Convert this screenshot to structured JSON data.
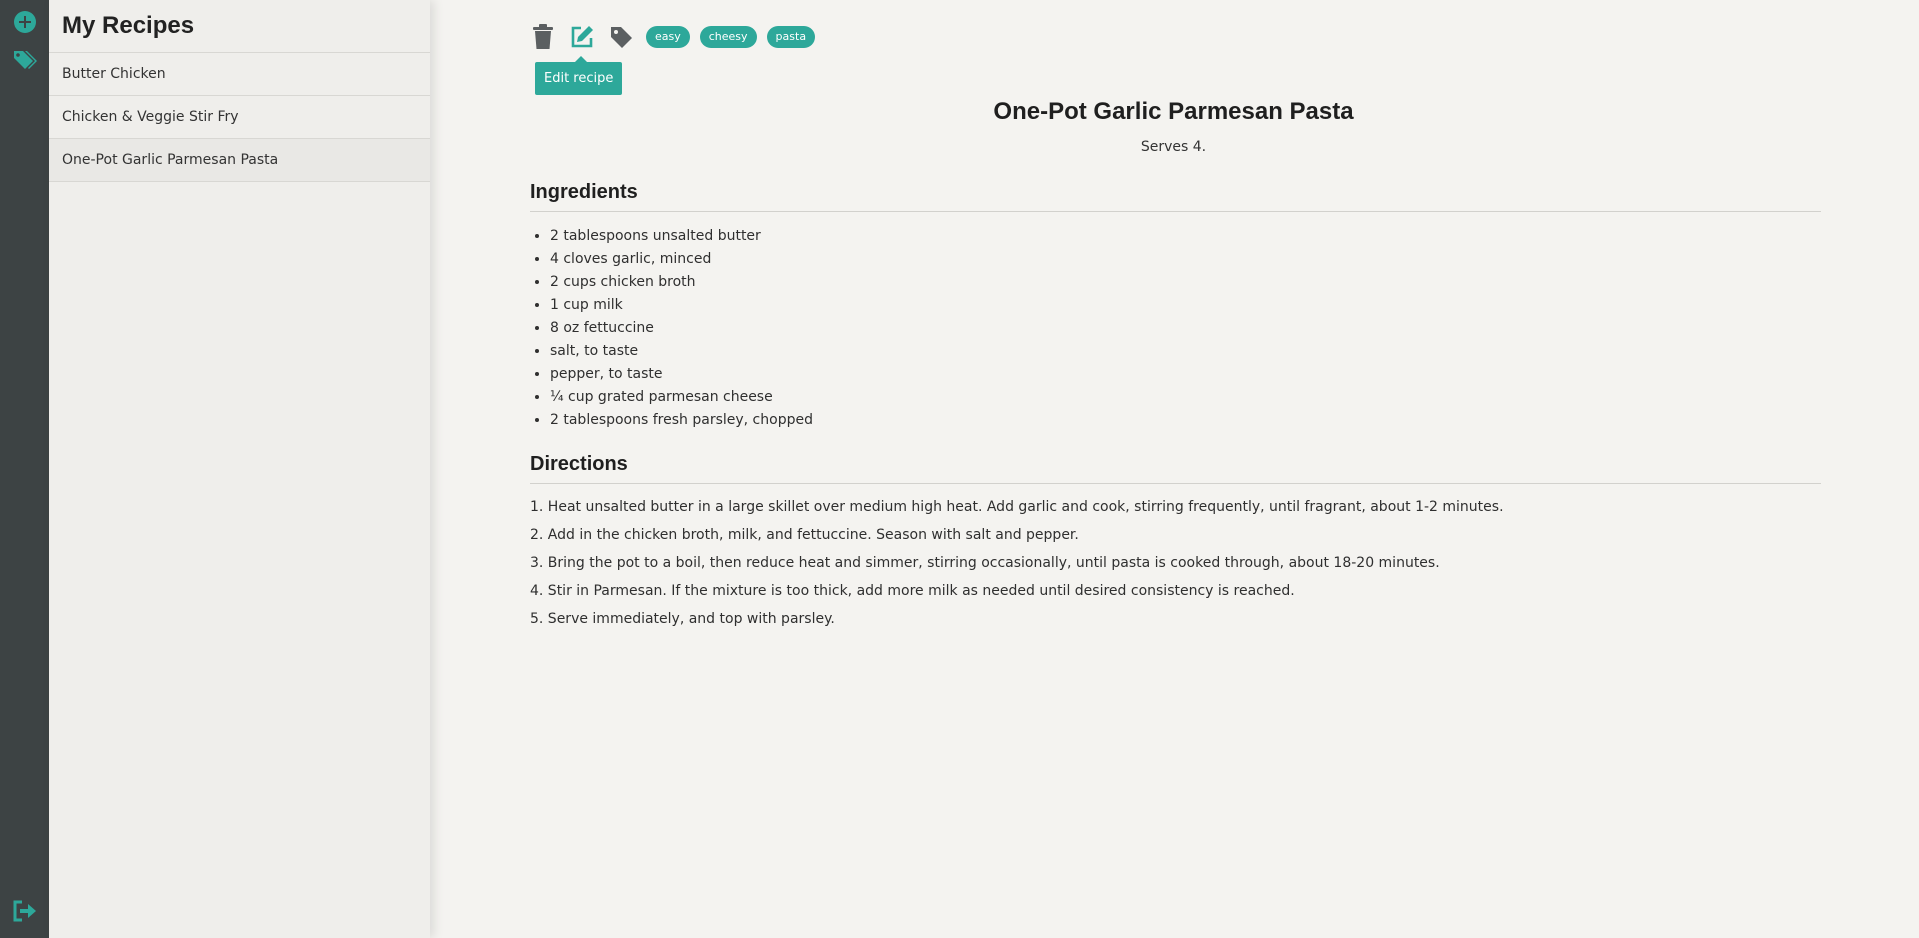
{
  "sidebar": {
    "title": "My Recipes",
    "recipes": [
      {
        "name": "Butter Chicken"
      },
      {
        "name": "Chicken & Veggie Stir Fry"
      },
      {
        "name": "One-Pot Garlic Parmesan Pasta"
      }
    ]
  },
  "rail": {
    "add_icon": "plus-circle-icon",
    "tags_icon": "tags-icon",
    "logout_icon": "sign-out-icon"
  },
  "toolbar": {
    "delete_icon": "trash-icon",
    "edit_icon": "edit-icon",
    "tag_icon": "tag-icon",
    "tags": [
      "easy",
      "cheesy",
      "pasta"
    ],
    "tooltip": "Edit recipe"
  },
  "recipe": {
    "title": "One-Pot Garlic Parmesan Pasta",
    "serves": "Serves 4.",
    "ingredients_heading": "Ingredients",
    "ingredients": [
      "2 tablespoons unsalted butter",
      "4 cloves garlic, minced",
      "2 cups chicken broth",
      "1 cup milk",
      "8 oz fettuccine",
      "salt, to taste",
      "pepper, to taste",
      "¼ cup grated parmesan cheese",
      "2 tablespoons fresh parsley, chopped"
    ],
    "directions_heading": "Directions",
    "directions": [
      "1. Heat unsalted butter in a large skillet over medium high heat. Add garlic and cook, stirring frequently, until fragrant, about 1-2 minutes.",
      "2. Add in the chicken broth, milk, and fettuccine. Season with salt and pepper.",
      "3. Bring the pot to a boil, then reduce heat and simmer, stirring occasionally, until pasta is cooked through, about 18-20 minutes.",
      "4. Stir in Parmesan. If the mixture is too thick, add more milk as needed until desired consistency is reached.",
      "5. Serve immediately, and top with parsley."
    ]
  },
  "colors": {
    "accent": "#2da89a",
    "rail": "#3d4344",
    "icon_gray": "#5b5f61"
  }
}
